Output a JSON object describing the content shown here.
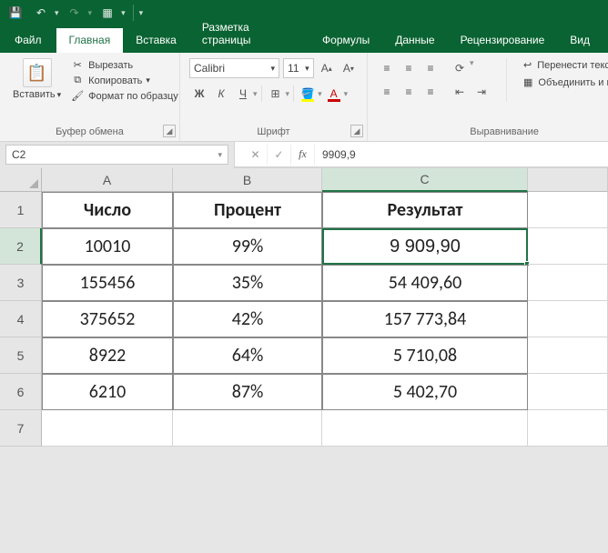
{
  "qat": {
    "save": "save-icon",
    "undo": "undo-icon",
    "redo": "redo-icon",
    "touch": "touch-mode-icon"
  },
  "tabs": {
    "file": "Файл",
    "items": [
      "Главная",
      "Вставка",
      "Разметка страницы",
      "Формулы",
      "Данные",
      "Рецензирование",
      "Вид"
    ],
    "activeIndex": 0
  },
  "ribbon": {
    "clipboard": {
      "paste": "Вставить",
      "cut": "Вырезать",
      "copy": "Копировать",
      "format_painter": "Формат по образцу",
      "group_label": "Буфер обмена"
    },
    "font": {
      "name": "Calibri",
      "size": "11",
      "group_label": "Шрифт"
    },
    "alignment": {
      "wrap": "Перенести текст",
      "merge": "Объединить и поме",
      "group_label": "Выравнивание"
    }
  },
  "formula_bar": {
    "name_box": "C2",
    "value": "9909,9"
  },
  "sheet": {
    "columns": [
      "A",
      "B",
      "C"
    ],
    "selected_cell": "C2",
    "headers": {
      "A": "Число",
      "B": "Процент",
      "C": "Результат"
    },
    "rows": [
      {
        "n": "1",
        "A": "Число",
        "B": "Процент",
        "C": "Результат"
      },
      {
        "n": "2",
        "A": "10010",
        "B": "99%",
        "C": "9 909,90"
      },
      {
        "n": "3",
        "A": "155456",
        "B": "35%",
        "C": "54 409,60"
      },
      {
        "n": "4",
        "A": "375652",
        "B": "42%",
        "C": "157 773,84"
      },
      {
        "n": "5",
        "A": "8922",
        "B": "64%",
        "C": "5 710,08"
      },
      {
        "n": "6",
        "A": "6210",
        "B": "87%",
        "C": "5 402,70"
      },
      {
        "n": "7",
        "A": "",
        "B": "",
        "C": ""
      }
    ]
  }
}
